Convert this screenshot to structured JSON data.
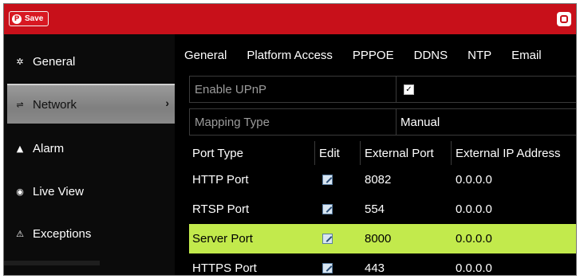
{
  "topbar": {
    "save_label": "Save",
    "save_icon": "pinterest-icon",
    "right_icon": "settings-square-icon",
    "color": "#c8101a"
  },
  "sidebar": {
    "items": [
      {
        "label": "General",
        "icon": "gear-icon"
      },
      {
        "label": "Network",
        "icon": "network-icon",
        "active": true
      },
      {
        "label": "Alarm",
        "icon": "alarm-bell-icon"
      },
      {
        "label": "Live View",
        "icon": "eye-icon"
      },
      {
        "label": "Exceptions",
        "icon": "warning-icon"
      }
    ]
  },
  "tabs": [
    "General",
    "Platform Access",
    "PPPOE",
    "DDNS",
    "NTP",
    "Email"
  ],
  "config": {
    "enable_upnp": {
      "label": "Enable UPnP",
      "checked": true
    },
    "mapping_type": {
      "label": "Mapping Type",
      "value": "Manual"
    }
  },
  "table": {
    "headers": [
      "Port Type",
      "Edit",
      "External Port",
      "External IP Address"
    ],
    "rows": [
      {
        "port_type": "HTTP Port",
        "external_port": "8082",
        "external_ip": "0.0.0.0"
      },
      {
        "port_type": "RTSP Port",
        "external_port": "554",
        "external_ip": "0.0.0.0"
      },
      {
        "port_type": "Server Port",
        "external_port": "8000",
        "external_ip": "0.0.0.0",
        "selected": true
      },
      {
        "port_type": "HTTPS Port",
        "external_port": "443",
        "external_ip": "0.0.0.0"
      }
    ],
    "selected_color": "#c2ea4c"
  }
}
